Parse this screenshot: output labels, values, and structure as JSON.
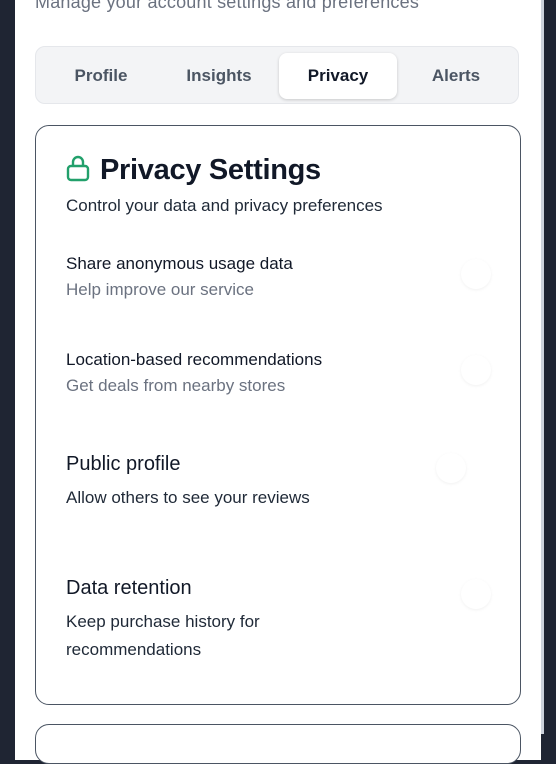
{
  "header": {
    "subtitle": "Manage your account settings and preferences"
  },
  "tabs": [
    {
      "label": "Profile",
      "active": false
    },
    {
      "label": "Insights",
      "active": false
    },
    {
      "label": "Privacy",
      "active": true
    },
    {
      "label": "Alerts",
      "active": false
    }
  ],
  "privacy": {
    "title": "Privacy Settings",
    "icon": "lock-icon",
    "description": "Control your data and privacy preferences",
    "settings": [
      {
        "title": "Share anonymous usage data",
        "help": "Help improve our service"
      },
      {
        "title": "Location-based recommendations",
        "help": "Get deals from nearby stores"
      },
      {
        "title": "Public profile",
        "help": "Allow others to see your reviews"
      },
      {
        "title": "Data retention",
        "help": "Keep purchase history for recommendations"
      }
    ]
  },
  "colors": {
    "accent": "#22a06b",
    "frame": "#1f2533",
    "card_border": "#4b5563"
  }
}
